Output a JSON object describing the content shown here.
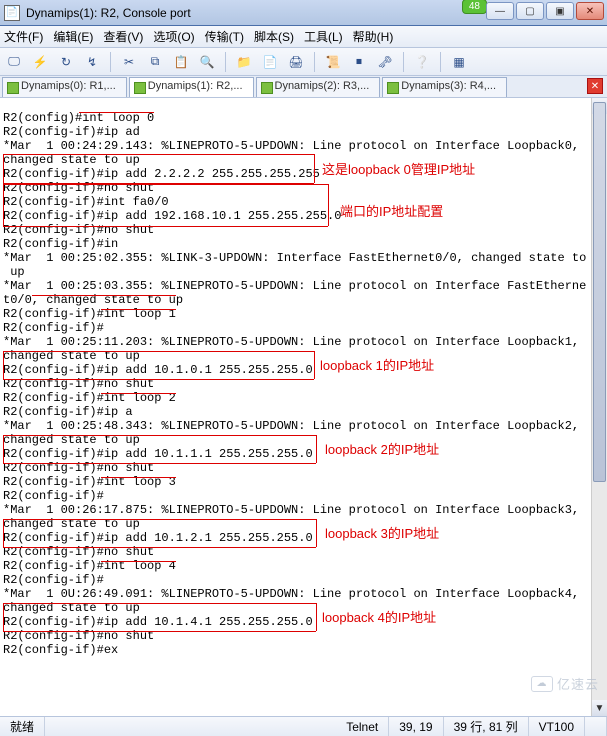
{
  "titlebar": {
    "title": "Dynamips(1): R2, Console port",
    "badge": "48"
  },
  "menu": {
    "file": "文件(F)",
    "edit": "编辑(E)",
    "view": "查看(V)",
    "options": "选项(O)",
    "transfer": "传输(T)",
    "script": "脚本(S)",
    "tools": "工具(L)",
    "help": "帮助(H)"
  },
  "tabs": [
    {
      "label": "Dynamips(0): R1,..."
    },
    {
      "label": "Dynamips(1): R2,..."
    },
    {
      "label": "Dynamips(2): R3,..."
    },
    {
      "label": "Dynamips(3): R4,..."
    }
  ],
  "annotations": {
    "lb0": "这是loopback 0管理IP地址",
    "fa0": "端口的IP地址配置",
    "lb1": "loopback 1的IP地址",
    "lb2": "loopback 2的IP地址",
    "lb3": "loopback 3的IP地址",
    "lb4": "loopback 4的IP地址"
  },
  "terminal": {
    "lines": [
      "R2(config)#int loop 0",
      "R2(config-if)#ip ad",
      "*Mar  1 00:24:29.143: %LINEPROTO-5-UPDOWN: Line protocol on Interface Loopback0,",
      "changed state to up",
      "R2(config-if)#ip add 2.2.2.2 255.255.255.255",
      "R2(config-if)#no shut",
      "R2(config-if)#int fa0/0",
      "R2(config-if)#ip add 192.168.10.1 255.255.255.0",
      "R2(config-if)#no shut",
      "R2(config-if)#in",
      "*Mar  1 00:25:02.355: %LINK-3-UPDOWN: Interface FastEthernet0/0, changed state to",
      " up",
      "*Mar  1 00:25:03.355: %LINEPROTO-5-UPDOWN: Line protocol on Interface FastEtherne",
      "t0/0, changed state to up",
      "R2(config-if)#int loop 1",
      "R2(config-if)#",
      "*Mar  1 00:25:11.203: %LINEPROTO-5-UPDOWN: Line protocol on Interface Loopback1,",
      "changed state to up",
      "R2(config-if)#ip add 10.1.0.1 255.255.255.0",
      "R2(config-if)#no shut",
      "R2(config-if)#int loop 2",
      "R2(config-if)#ip a",
      "*Mar  1 00:25:48.343: %LINEPROTO-5-UPDOWN: Line protocol on Interface Loopback2,",
      "changed state to up",
      "R2(config-if)#ip add 10.1.1.1 255.255.255.0",
      "R2(config-if)#no shut",
      "R2(config-if)#int loop 3",
      "R2(config-if)#",
      "*Mar  1 00:26:17.875: %LINEPROTO-5-UPDOWN: Line protocol on Interface Loopback3,",
      "changed state to up",
      "R2(config-if)#ip add 10.1.2.1 255.255.255.0",
      "R2(config-if)#no shut",
      "R2(config-if)#int loop 4",
      "R2(config-if)#",
      "*Mar  1 0U:26:49.091: %LINEPROTO-5-UPDOWN: Line protocol on Interface Loopback4,",
      "changed state to up",
      "R2(config-if)#ip add 10.1.4.1 255.255.255.0",
      "R2(config-if)#no shut",
      "R2(config-if)#ex"
    ]
  },
  "status": {
    "state": "就绪",
    "proto": "Telnet",
    "cursor": "39, 19",
    "viewport": "39 行, 81 列",
    "emulation": "VT100"
  },
  "watermark": "亿速云"
}
